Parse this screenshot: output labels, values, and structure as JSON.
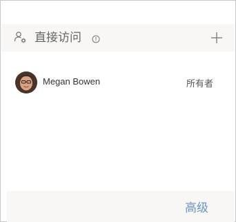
{
  "header": {
    "title": "直接访问",
    "people_icon": "people-settings-icon",
    "info_icon": "info-icon",
    "add_icon": "plus-icon"
  },
  "members": [
    {
      "name": "Megan Bowen",
      "role": "所有者",
      "avatar_icon": "avatar-photo"
    }
  ],
  "footer": {
    "advanced_label": "高级"
  },
  "colors": {
    "header_bg": "#f8f7f6",
    "link": "#6b95c5",
    "border": "#c8c8c8"
  }
}
